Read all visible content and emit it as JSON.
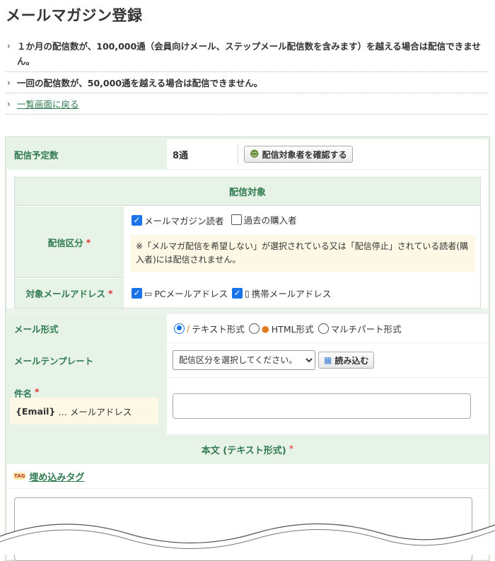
{
  "page": {
    "title": "メールマガジン登録"
  },
  "notes": [
    "１か月の配信数が、100,000通（会員向けメール、ステップメール配信数を含みます）を越える場合は配信できません。",
    "一回の配信数が、50,000通を越える場合は配信できません。"
  ],
  "back_link": "一覧画面に戻る",
  "schedule": {
    "label": "配信予定数",
    "count": "8通",
    "confirm_button": "配信対象者を確認する"
  },
  "target": {
    "heading": "配信対象",
    "category_label": "配信区分",
    "required_mark": "*",
    "options": [
      "メールマガジン読者",
      "過去の購入者"
    ],
    "notice": "※「メルマガ配信を希望しない」が選択されている又は「配信停止」されている読者(購入者)には配信されません。",
    "address_label": "対象メールアドレス",
    "address_options": [
      "PCメールアドレス",
      "携帯メールアドレス"
    ]
  },
  "format": {
    "label": "メール形式",
    "options": [
      "テキスト形式",
      "HTML形式",
      "マルチパート形式"
    ]
  },
  "template": {
    "label": "メールテンプレート",
    "select_value": "配信区分を選択してください。",
    "load_button": "読み込む"
  },
  "subject": {
    "label": "件名",
    "hint_tag": "{Email}",
    "hint_text": "… メールアドレス"
  },
  "body": {
    "heading": "本文 (テキスト形式)",
    "embed_tag_link": "埋め込みタグ",
    "tag_icon_text": "TAG"
  },
  "colors": {
    "label_green": "#2f7a50",
    "label_bg": "#e8f3e8",
    "accent_blue": "#1a73e8",
    "notice_bg": "#fcf8e5",
    "required_red": "#dd3333"
  }
}
